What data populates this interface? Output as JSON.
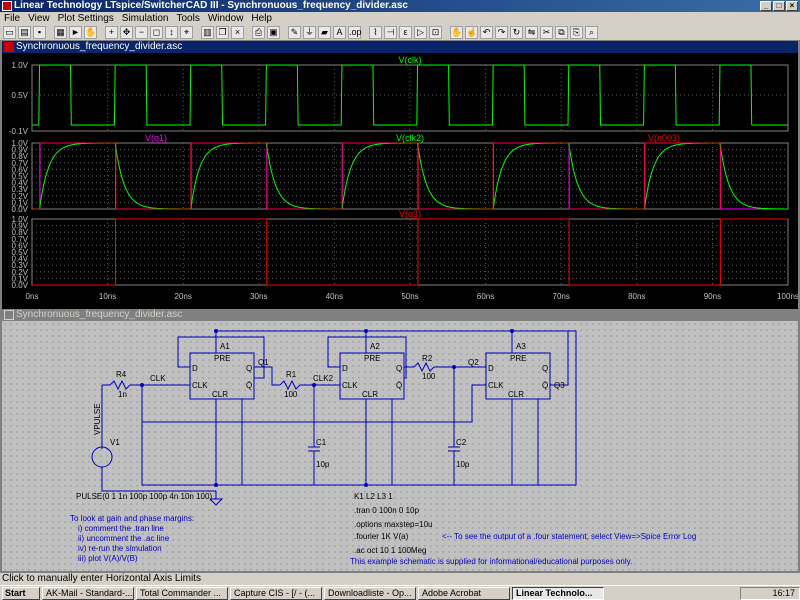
{
  "window": {
    "title": "Linear Technology LTspice/SwitcherCAD III - Synchronuous_frequency_divider.asc"
  },
  "menu": [
    "File",
    "View",
    "Plot Settings",
    "Simulation",
    "Tools",
    "Window",
    "Help"
  ],
  "plot_window": {
    "title": "Synchronuous_frequency_divider.asc"
  },
  "schematic_window": {
    "title": "Synchronuous_frequency_divider.asc"
  },
  "status": "Click to manually enter Horizontal Axis Limits",
  "taskbar": {
    "start": "Start",
    "items": [
      "AK-Mail - Standard-...",
      "Total Commander ...",
      "Capture CIS - [/ - (...",
      "Downloadliste - Op...",
      "Adobe Acrobat",
      "Linear Technolo..."
    ],
    "clock": "16:17"
  },
  "colors": {
    "clk": "#00ff00",
    "q1": "#ff00ff",
    "clk2": "#00ff00",
    "n003": "#ff0000",
    "q3": "#ff0000",
    "wire": "#0000c0"
  },
  "chart_data": [
    {
      "type": "line",
      "title": "V(clk)",
      "yticks": [
        "1.0V",
        "0.5V",
        "-0.1V"
      ],
      "ylim": [
        -0.1,
        1.0
      ],
      "series": [
        {
          "name": "V(clk)",
          "description": "square wave 0 to 1V period 10ns, falls ~1ns, rises ~5ns"
        }
      ]
    },
    {
      "type": "line",
      "title": "V(q1) V(clk2) V(n003)",
      "yticks": [
        "1.0V",
        "0.9V",
        "0.8V",
        "0.7V",
        "0.6V",
        "0.5V",
        "0.4V",
        "0.3V",
        "0.2V",
        "0.1V",
        "0.0V"
      ],
      "ylim": [
        0,
        1.0
      ],
      "series": [
        {
          "name": "V(q1)"
        },
        {
          "name": "V(clk2)"
        },
        {
          "name": "V(n003)"
        }
      ]
    },
    {
      "type": "line",
      "title": "V(q3)",
      "yticks": [
        "1.0V",
        "0.9V",
        "0.8V",
        "0.7V",
        "0.6V",
        "0.5V",
        "0.4V",
        "0.3V",
        "0.2V",
        "0.1V",
        "0.0V"
      ],
      "ylim": [
        0,
        1.0
      ],
      "series": [
        {
          "name": "V(q3)"
        }
      ]
    }
  ],
  "xaxis": {
    "ticks": [
      "0ns",
      "10ns",
      "20ns",
      "30ns",
      "40ns",
      "50ns",
      "60ns",
      "70ns",
      "80ns",
      "90ns",
      "100ns"
    ]
  },
  "schematic": {
    "flipflops": [
      {
        "ref": "A1",
        "pins": [
          "PRE",
          "D",
          "Q",
          "CLK",
          "Q̄",
          "CLR"
        ]
      },
      {
        "ref": "A2",
        "pins": [
          "PRE",
          "D",
          "Q",
          "CLK",
          "Q̄",
          "CLR"
        ]
      },
      {
        "ref": "A3",
        "pins": [
          "PRE",
          "D",
          "Q",
          "CLK",
          "Q̄",
          "CLR"
        ]
      }
    ],
    "labels": {
      "r4": "R4",
      "r4v": "1n",
      "clk": "CLK",
      "q1": "Q1",
      "r1": "R1",
      "r1v": "100",
      "clk2": "CLK2",
      "r2": "R2",
      "r2v": "100",
      "q2": "Q2",
      "q3": "Q3",
      "c1": "C1",
      "c1v": "10p",
      "c2": "C2",
      "c2v": "10p",
      "v1": "V1",
      "vpulse": "VPULSE"
    },
    "pulse": "PULSE(0 1 1n 100p 100p 4n 10n 100)",
    "directives": [
      "K1 L2 L3 1",
      ".tran 0 100n 0 10p",
      ".options maxstep=10u",
      ".fourier 1K V(a)",
      ".ac oct 10 1 100Meg"
    ],
    "fourier_note": "<-- To see the output of a .four statement, select View=>Spice Error Log",
    "info_note": "This example schematic is supplied for informational/educational purposes only.",
    "instructions": [
      "To look at gain and phase margins:",
      "i) comment the .tran line",
      "ii) uncomment the .ac line",
      "iv) re-run the simulation",
      "iii) plot V(A)/V(B)"
    ]
  }
}
